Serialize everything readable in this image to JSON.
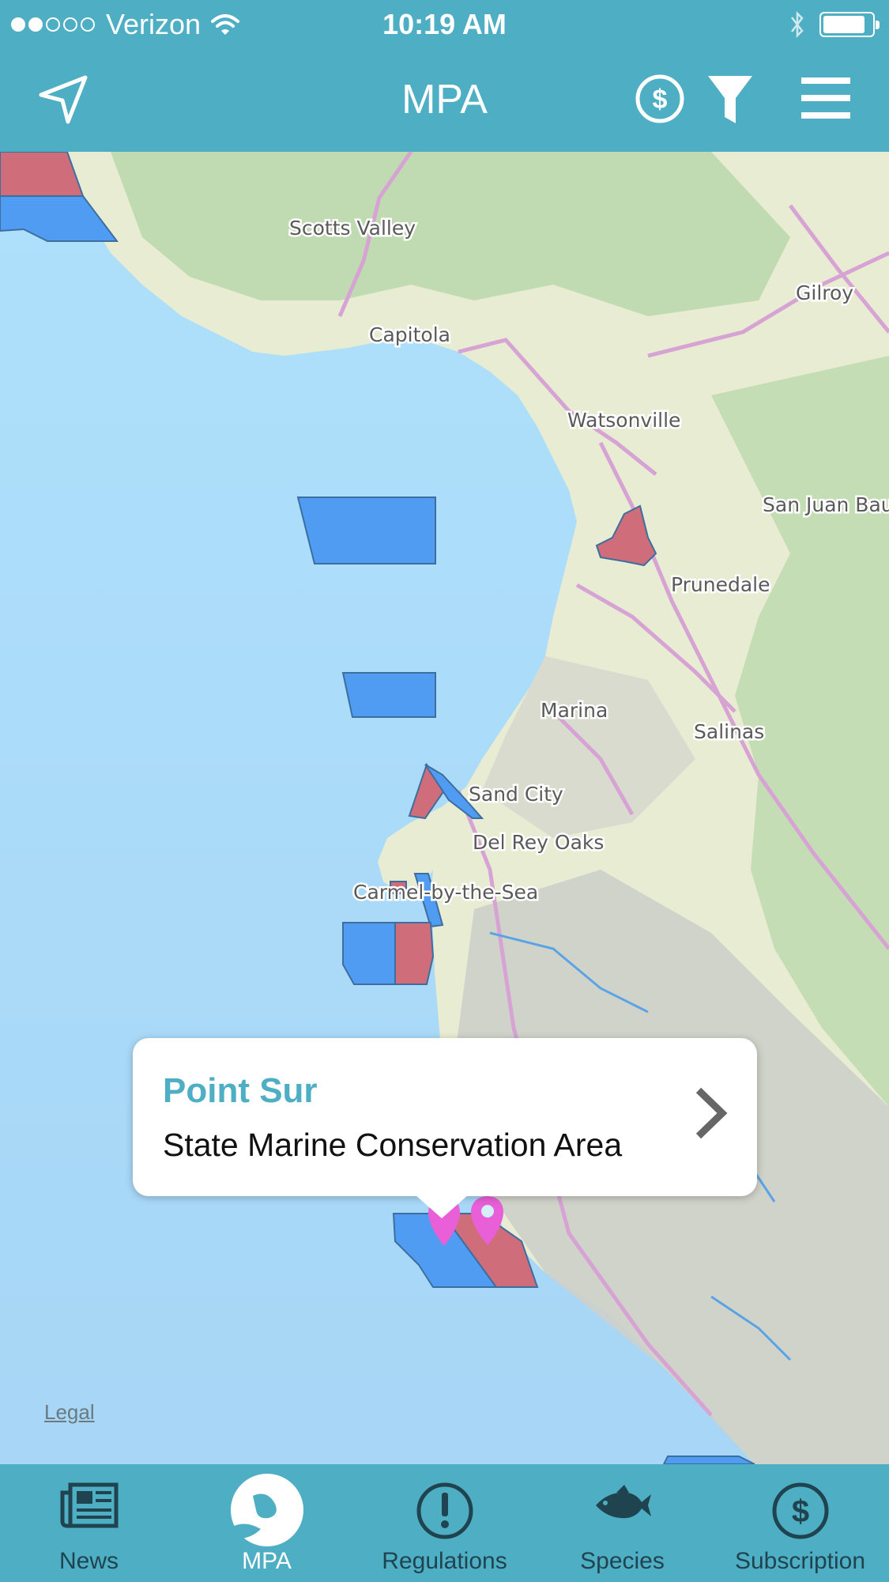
{
  "status_bar": {
    "carrier": "Verizon",
    "time": "10:19 AM",
    "signal_bars_filled": 2,
    "signal_bars_total": 5
  },
  "nav": {
    "title": "MPA",
    "icons": [
      "location-arrow-icon",
      "dollar-circle-icon",
      "filter-icon",
      "hamburger-menu-icon"
    ]
  },
  "map": {
    "places": {
      "scotts_valley": "Scotts Valley",
      "capitola": "Capitola",
      "gilroy": "Gilroy",
      "watsonville": "Watsonville",
      "san_juan": "San Juan Bau",
      "prunedale": "Prunedale",
      "marina": "Marina",
      "salinas": "Salinas",
      "sand_city": "Sand City",
      "del_rey_oaks": "Del Rey Oaks",
      "carmel": "Carmel-by-the-Sea"
    },
    "legal_link": "Legal",
    "colors": {
      "water": "#a9d7f7",
      "land": "#e8ecd2",
      "mpa_blue": "#4f9cf2",
      "mpa_red": "#cf6d7b",
      "pin": "#e85fd7"
    }
  },
  "callout": {
    "title": "Point Sur",
    "subtitle": "State Marine Conservation Area"
  },
  "tabs": [
    {
      "label": "News",
      "icon": "newspaper-icon",
      "active": false
    },
    {
      "label": "MPA",
      "icon": "mpa-logo-icon",
      "active": true
    },
    {
      "label": "Regulations",
      "icon": "exclamation-circle-icon",
      "active": false
    },
    {
      "label": "Species",
      "icon": "fish-icon",
      "active": false
    },
    {
      "label": "Subscription",
      "icon": "dollar-circle-icon",
      "active": false
    }
  ]
}
